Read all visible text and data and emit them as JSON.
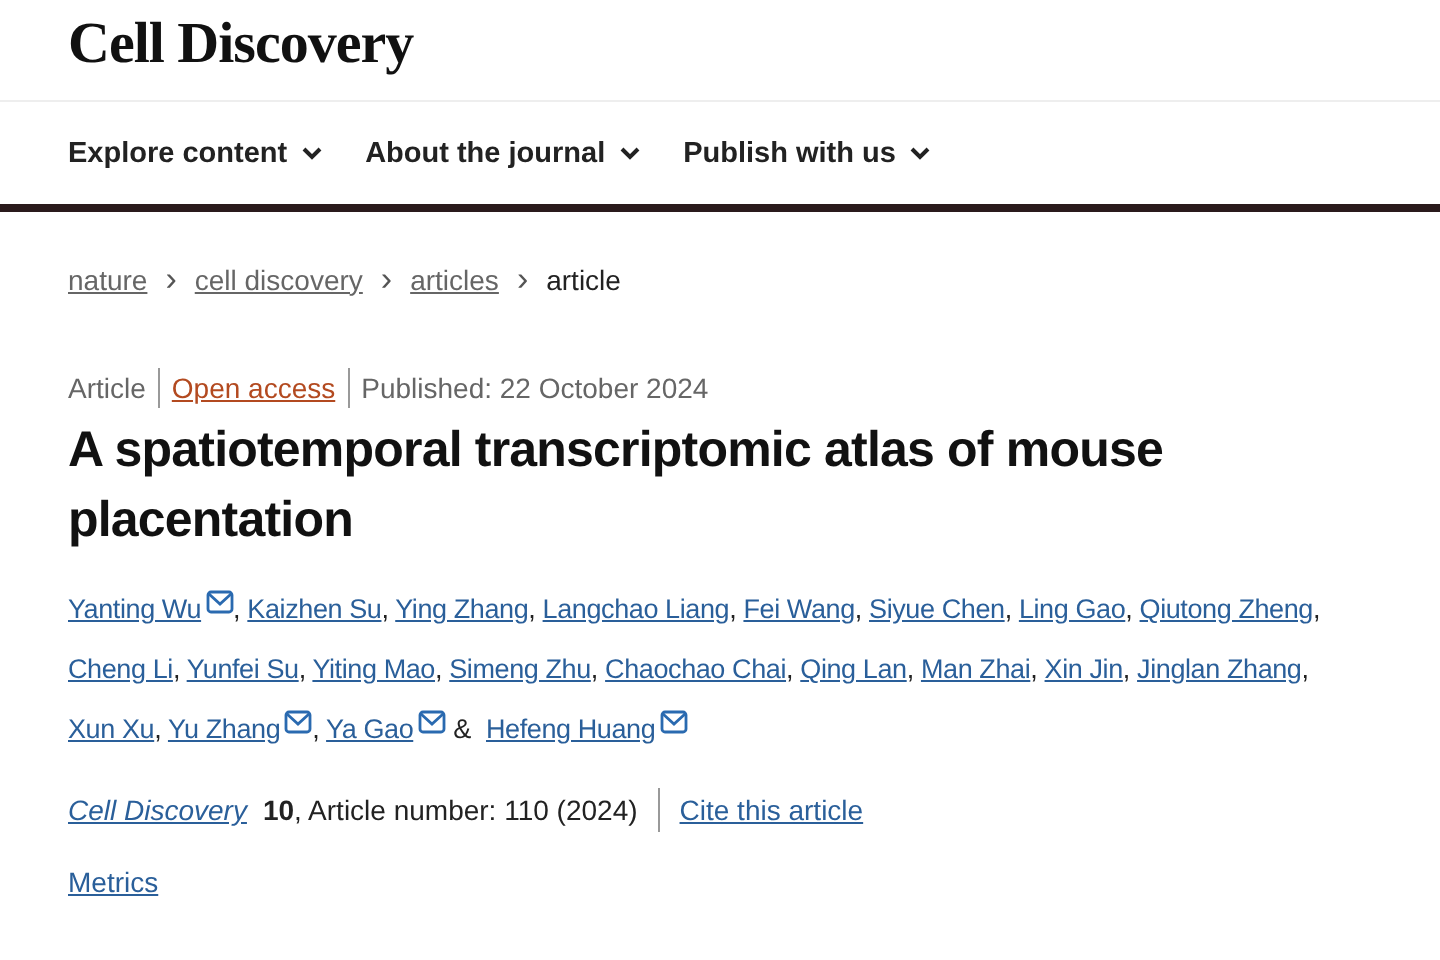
{
  "site": {
    "logo": "Cell Discovery"
  },
  "nav": [
    {
      "label": "Explore content"
    },
    {
      "label": "About the journal"
    },
    {
      "label": "Publish with us"
    }
  ],
  "breadcrumbs": [
    {
      "label": "nature",
      "link": true
    },
    {
      "label": "cell discovery",
      "link": true
    },
    {
      "label": "articles",
      "link": true
    },
    {
      "label": "article",
      "link": false
    }
  ],
  "breadcrumb_separator": "›",
  "meta": [
    {
      "label": "Article",
      "kind": "type"
    },
    {
      "label": "Open access",
      "kind": "access"
    },
    {
      "label": "Published: 22 October 2024",
      "kind": "date"
    }
  ],
  "title": "A spatiotemporal transcriptomic atlas of mouse placentation",
  "authors": [
    {
      "name": "Yanting Wu",
      "corresponding": true,
      "after": ","
    },
    {
      "name": "Kaizhen Su",
      "corresponding": false,
      "after": ","
    },
    {
      "name": "Ying Zhang",
      "corresponding": false,
      "after": ","
    },
    {
      "name": "Langchao Liang",
      "corresponding": false,
      "after": ","
    },
    {
      "name": "Fei Wang",
      "corresponding": false,
      "after": ","
    },
    {
      "name": "Siyue Chen",
      "corresponding": false,
      "after": ","
    },
    {
      "name": "Ling Gao",
      "corresponding": false,
      "after": ","
    },
    {
      "name": "Qiutong Zheng",
      "corresponding": false,
      "after": ","
    },
    {
      "name": "Cheng Li",
      "corresponding": false,
      "after": ","
    },
    {
      "name": "Yunfei Su",
      "corresponding": false,
      "after": ","
    },
    {
      "name": "Yiting Mao",
      "corresponding": false,
      "after": ","
    },
    {
      "name": "Simeng Zhu",
      "corresponding": false,
      "after": ","
    },
    {
      "name": "Chaochao Chai",
      "corresponding": false,
      "after": ","
    },
    {
      "name": "Qing Lan",
      "corresponding": false,
      "after": ","
    },
    {
      "name": "Man Zhai",
      "corresponding": false,
      "after": ","
    },
    {
      "name": "Xin Jin",
      "corresponding": false,
      "after": ","
    },
    {
      "name": "Jinglan Zhang",
      "corresponding": false,
      "after": ","
    },
    {
      "name": "Xun Xu",
      "corresponding": false,
      "after": ","
    },
    {
      "name": "Yu Zhang",
      "corresponding": true,
      "after": ","
    },
    {
      "name": "Ya Gao",
      "corresponding": true,
      "after": "&"
    },
    {
      "name": "Hefeng Huang",
      "corresponding": true
    }
  ],
  "citation": {
    "journal": "Cell Discovery",
    "details": "**10**, Article number: 110 (2024)",
    "cite_link": "Cite this article"
  },
  "metrics_link": "Metrics"
}
